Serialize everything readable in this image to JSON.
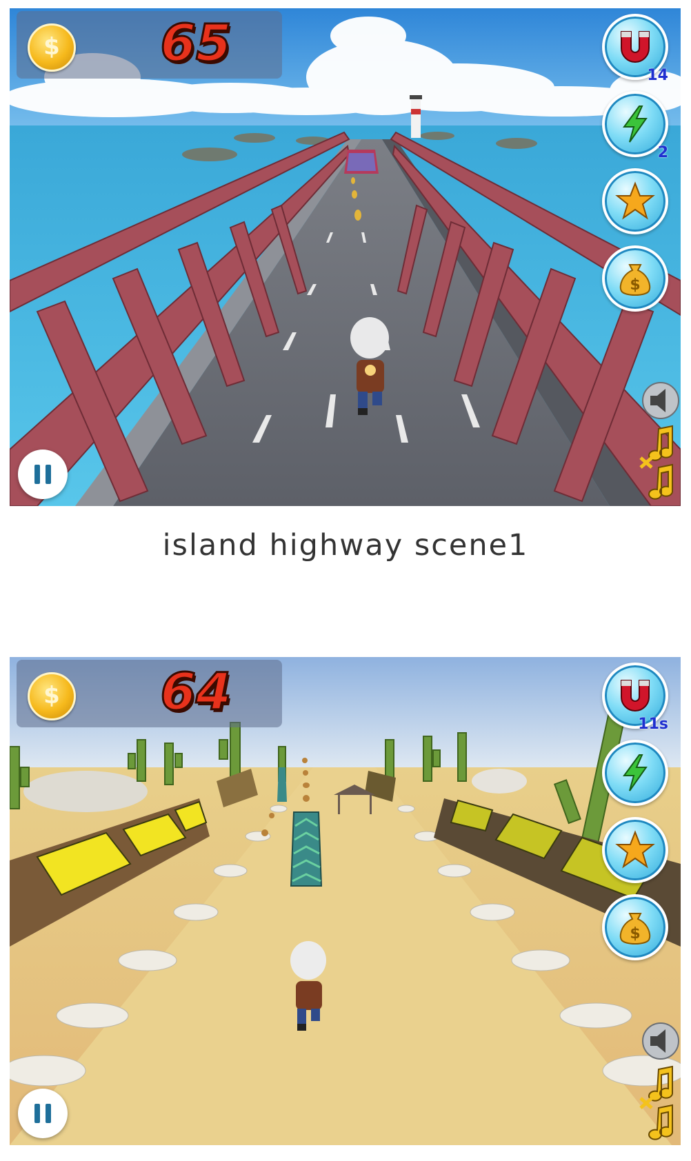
{
  "caption": "island highway scene1",
  "icons": {
    "coin": "coin-icon",
    "magnet": "magnet-icon",
    "lightning": "lightning-icon",
    "star": "star-icon",
    "money_bag": "money-bag-icon",
    "pause": "pause-icon",
    "speaker": "speaker-icon",
    "music_off": "music-muted-icon"
  },
  "scene1": {
    "score": "65",
    "magnet_count": "14",
    "lightning_count": "2"
  },
  "scene2": {
    "score": "64",
    "magnet_count": "11s"
  }
}
